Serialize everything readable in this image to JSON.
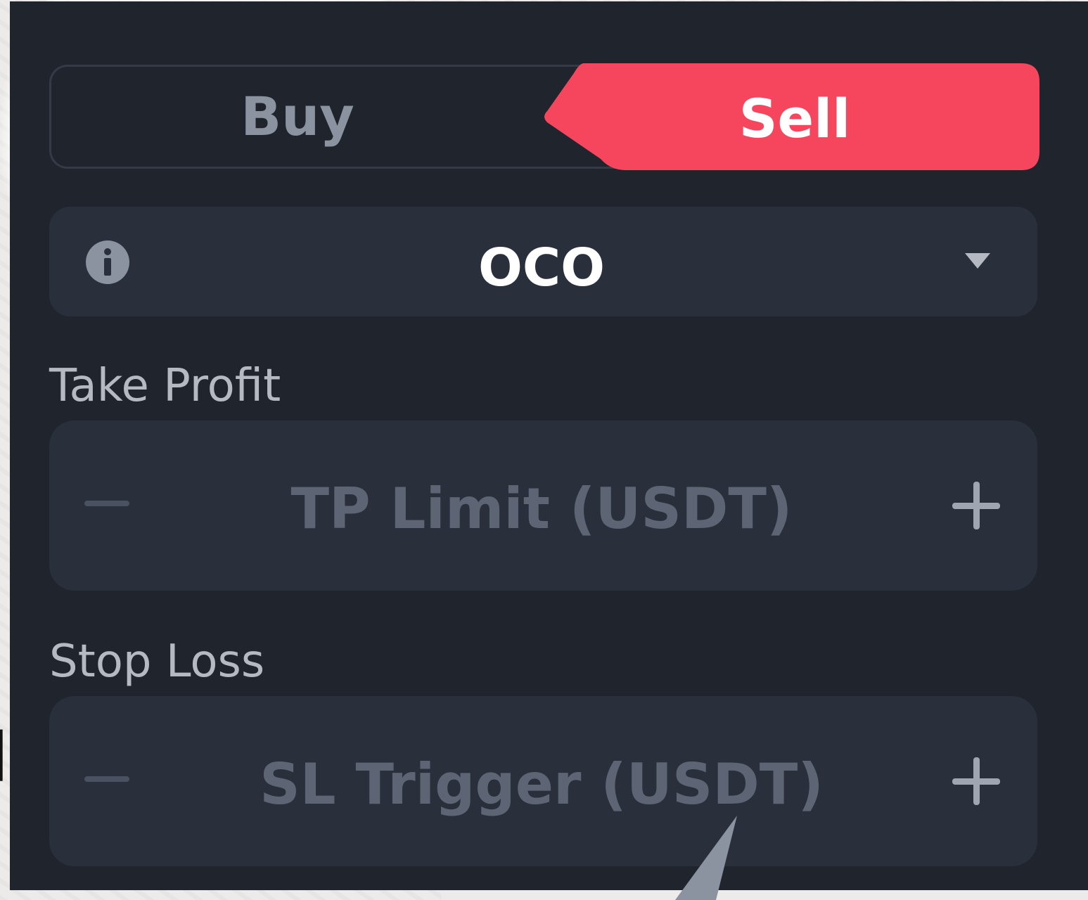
{
  "order_form": {
    "tabs": {
      "buy_label": "Buy",
      "sell_label": "Sell",
      "active": "Sell"
    },
    "order_type": {
      "value": "OCO",
      "info_icon": "info-icon",
      "caret_icon": "caret-down-icon"
    },
    "take_profit": {
      "label": "Take Profit",
      "placeholder": "TP Limit (USDT)",
      "value": "",
      "decrement_icon": "minus-icon",
      "increment_icon": "plus-icon"
    },
    "stop_loss": {
      "label": "Stop Loss",
      "placeholder": "SL Trigger (USDT)",
      "value": "",
      "decrement_icon": "minus-icon",
      "increment_icon": "plus-icon"
    }
  },
  "colors": {
    "panel_background": "#1f242d",
    "field_background": "#2a303b",
    "sell_accent": "#f6465d",
    "placeholder_text": "#5d6575",
    "label_text": "#b4b9c2"
  }
}
